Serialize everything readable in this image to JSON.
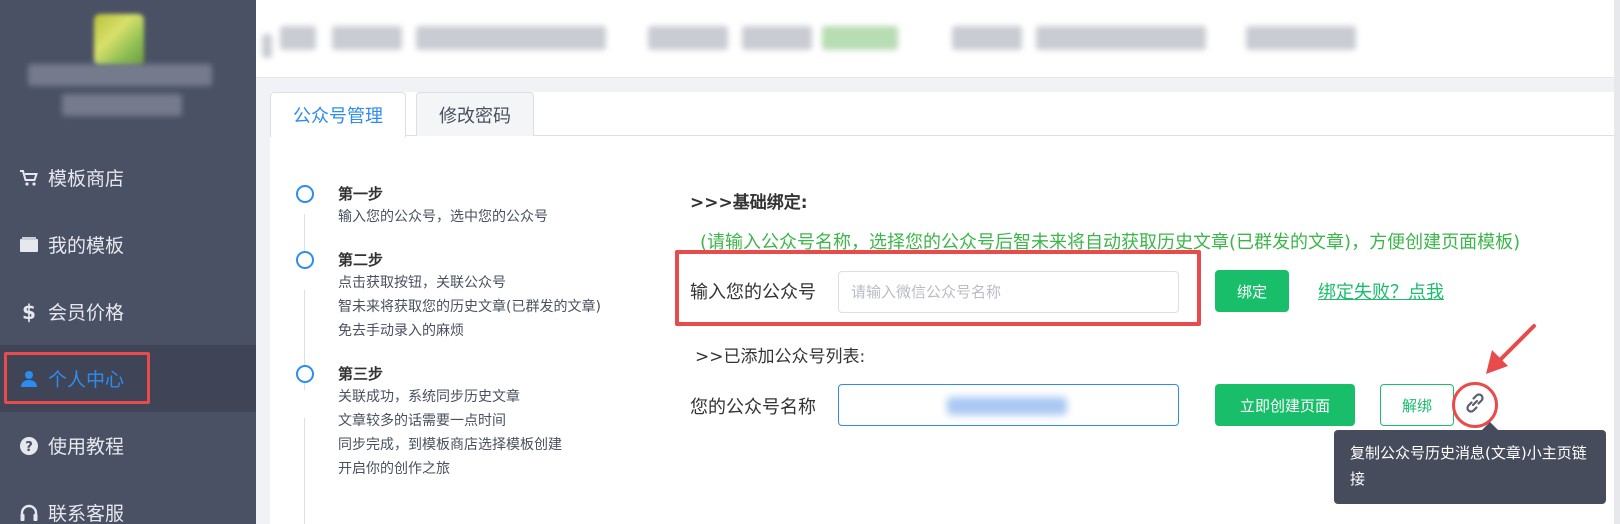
{
  "sidebar": {
    "menu": [
      {
        "label": "模板商店",
        "icon": "cart-icon"
      },
      {
        "label": "我的模板",
        "icon": "folder-icon"
      },
      {
        "label": "会员价格",
        "icon": "dollar-icon"
      },
      {
        "label": "个人中心",
        "icon": "user-icon"
      },
      {
        "label": "使用教程",
        "icon": "help-icon"
      },
      {
        "label": "联系客服",
        "icon": "headset-icon"
      }
    ],
    "active_index": 3
  },
  "tabs": [
    {
      "label": "公众号管理",
      "active": true
    },
    {
      "label": "修改密码",
      "active": false
    }
  ],
  "steps": [
    {
      "title": "第一步",
      "lines": [
        "输入您的公众号，选中您的公众号"
      ]
    },
    {
      "title": "第二步",
      "lines": [
        "点击获取按钮，关联公众号",
        "智未来将获取您的历史文章(已群发的文章)",
        "免去手动录入的麻烦"
      ]
    },
    {
      "title": "第三步",
      "lines": [
        "关联成功，系统同步历史文章",
        "文章较多的话需要一点时间",
        "同步完成，到模板商店选择模板创建",
        "开启你的创作之旅"
      ]
    }
  ],
  "bind": {
    "heading": ">>>基础绑定:",
    "note": "(请输入公众号名称，选择您的公众号后智未来将自动获取历史文章(已群发的文章)，方便创建页面模板)",
    "input_label": "输入您的公众号",
    "input_placeholder": "请输入微信公众号名称",
    "bind_button": "绑定",
    "fail_link": "绑定失败？点我"
  },
  "list": {
    "heading": ">>已添加公众号列表:",
    "name_label": "您的公众号名称",
    "create_button": "立即创建页面",
    "unbind_button": "解绑",
    "link_icon": "link-icon",
    "tooltip": "复制公众号历史消息(文章)小主页链接"
  },
  "colors": {
    "sidebar_bg": "#4a5164",
    "accent_blue": "#2d8cf0",
    "green": "#19be6b",
    "note_green": "#3cb64a",
    "highlight_red": "#e84b4b",
    "tooltip_bg": "#464c5b"
  }
}
